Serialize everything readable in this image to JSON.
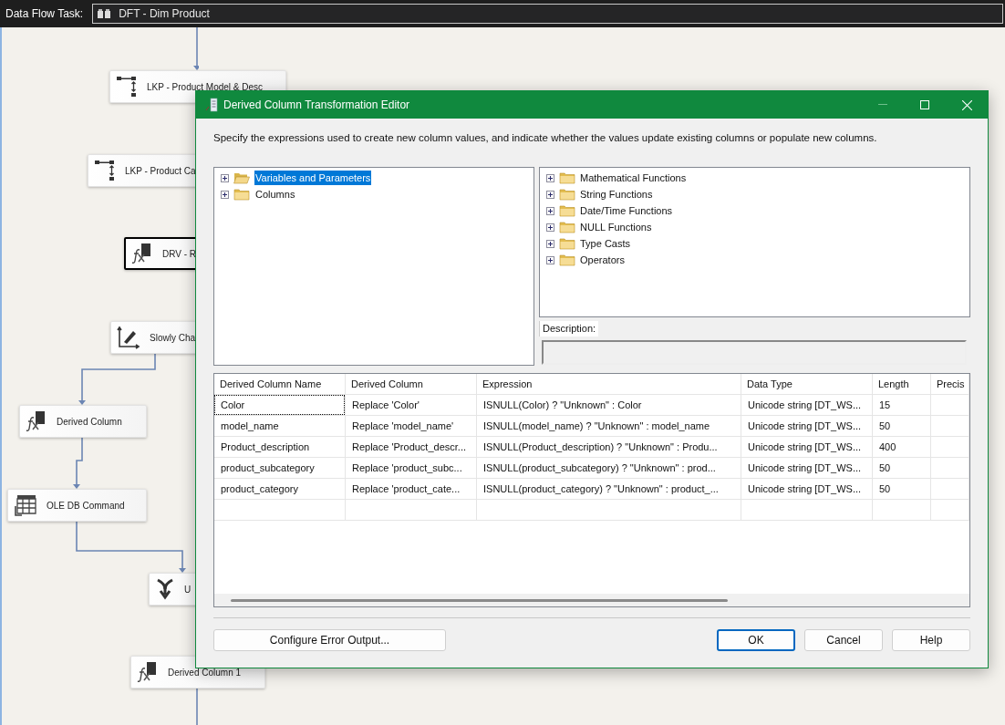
{
  "canvas": {
    "task_label": "Data Flow Task:",
    "task_name": "DFT - Dim Product",
    "nodes": [
      {
        "kind": "lookup",
        "label": "LKP - Product Model & Desc",
        "selected": false
      },
      {
        "kind": "lookup",
        "label": "LKP - Product Ca",
        "selected": false
      },
      {
        "kind": "derived",
        "label": "DRV - R",
        "selected": true
      },
      {
        "kind": "scd",
        "label": "Slowly Cha",
        "selected": false
      },
      {
        "kind": "derived",
        "label": "Derived Column",
        "selected": false
      },
      {
        "kind": "oledb",
        "label": "OLE DB Command",
        "selected": false
      },
      {
        "kind": "union",
        "label": "U",
        "selected": false
      },
      {
        "kind": "derived",
        "label": "Derived Column 1",
        "selected": false
      }
    ]
  },
  "dialog": {
    "title": "Derived Column Transformation Editor",
    "instructions": "Specify the expressions used to create new column values, and indicate whether the values update existing columns or populate new columns.",
    "variables_tree": [
      {
        "label": "Variables and Parameters",
        "selected": true,
        "expanded": false
      },
      {
        "label": "Columns",
        "selected": false,
        "expanded": false
      }
    ],
    "functions_tree": [
      {
        "label": "Mathematical Functions",
        "expanded": false
      },
      {
        "label": "String Functions",
        "expanded": false
      },
      {
        "label": "Date/Time Functions",
        "expanded": false
      },
      {
        "label": "NULL Functions",
        "expanded": false
      },
      {
        "label": "Type Casts",
        "expanded": false
      },
      {
        "label": "Operators",
        "expanded": false
      }
    ],
    "description_label": "Description:",
    "grid": {
      "columns": [
        "Derived Column Name",
        "Derived Column",
        "Expression",
        "Data Type",
        "Length",
        "Precis"
      ],
      "rows": [
        {
          "cells": [
            "Color",
            "Replace 'Color'",
            "ISNULL(Color) ? \"Unknown\" : Color",
            "Unicode string [DT_WS...",
            "15"
          ],
          "selected": true
        },
        {
          "cells": [
            "model_name",
            "Replace 'model_name'",
            "ISNULL(model_name) ? \"Unknown\" : model_name",
            "Unicode string [DT_WS...",
            "50"
          ],
          "selected": false
        },
        {
          "cells": [
            "Product_description",
            "Replace 'Product_descr...",
            "ISNULL(Product_description) ? \"Unknown\" : Produ...",
            "Unicode string [DT_WS...",
            "400"
          ],
          "selected": false
        },
        {
          "cells": [
            "product_subcategory",
            "Replace 'product_subc...",
            "ISNULL(product_subcategory) ? \"Unknown\" : prod...",
            "Unicode string [DT_WS...",
            "50"
          ],
          "selected": false
        },
        {
          "cells": [
            "product_category",
            "Replace 'product_cate...",
            "ISNULL(product_category) ? \"Unknown\" : product_...",
            "Unicode string [DT_WS...",
            "50"
          ],
          "selected": false
        }
      ]
    },
    "buttons": [
      {
        "label": "Configure Error Output...",
        "default": false
      },
      {
        "label": "OK",
        "default": true
      },
      {
        "label": "Cancel",
        "default": false
      },
      {
        "label": "Help",
        "default": false
      }
    ]
  }
}
